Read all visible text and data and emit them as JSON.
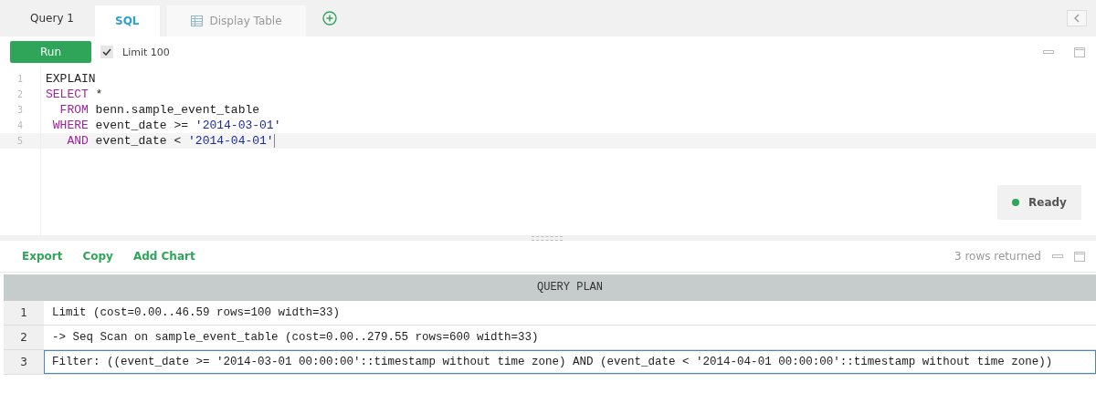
{
  "query_title": "Query 1",
  "tabs": [
    {
      "label": "SQL",
      "kind": "tab",
      "selected": true
    },
    {
      "label": "Display Table",
      "kind": "table",
      "selected": false
    }
  ],
  "toolbar": {
    "run_button": "Run",
    "limit": {
      "label": "Limit 100",
      "checked": true
    }
  },
  "editor": {
    "lines": [
      {
        "number": "1",
        "current": false,
        "tokens": [
          {
            "text": "EXPLAIN",
            "kind": "plain"
          }
        ]
      },
      {
        "number": "2",
        "current": false,
        "tokens": [
          {
            "text": "SELECT",
            "kind": "keyword"
          },
          {
            "text": " *",
            "kind": "plain"
          }
        ]
      },
      {
        "number": "3",
        "current": false,
        "tokens": [
          {
            "text": "  FROM",
            "kind": "keyword"
          },
          {
            "text": " benn.sample_event_table",
            "kind": "plain"
          }
        ]
      },
      {
        "number": "4",
        "current": false,
        "tokens": [
          {
            "text": " WHERE",
            "kind": "keyword"
          },
          {
            "text": " event_date >= ",
            "kind": "plain"
          },
          {
            "text": "'2014-03-01'",
            "kind": "string"
          }
        ]
      },
      {
        "number": "5",
        "current": true,
        "tokens": [
          {
            "text": "   AND",
            "kind": "keyword"
          },
          {
            "text": " event_date < ",
            "kind": "plain"
          },
          {
            "text": "'2014-04-01'",
            "kind": "string"
          }
        ]
      }
    ],
    "status": {
      "label": "Ready",
      "color": "#2fa55a"
    }
  },
  "results": {
    "actions": [
      "Export",
      "Copy",
      "Add Chart"
    ],
    "count": "3 rows returned",
    "table": {
      "columns": [
        "QUERY PLAN"
      ],
      "rows": [
        {
          "number": "1",
          "selected": false,
          "cells": [
            "Limit (cost=0.00..46.59 rows=100 width=33)"
          ]
        },
        {
          "number": "2",
          "selected": false,
          "cells": [
            "-> Seq Scan on sample_event_table (cost=0.00..279.55 rows=600 width=33)"
          ]
        },
        {
          "number": "3",
          "selected": true,
          "cells": [
            "Filter: ((event_date >= '2014-03-01 00:00:00'::timestamp without time zone) AND (event_date < '2014-04-01 00:00:00'::timestamp without time zone))"
          ]
        }
      ]
    }
  }
}
